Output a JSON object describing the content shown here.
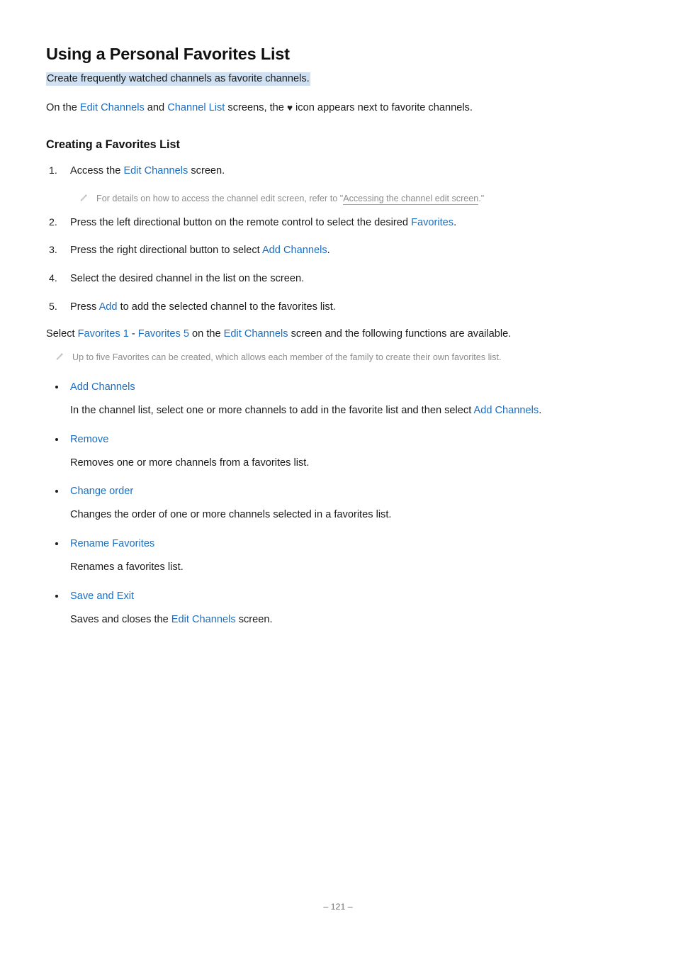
{
  "document": {
    "title": "Using a Personal Favorites List",
    "highlighted_subtitle": "Create frequently watched channels as favorite channels.",
    "intro": {
      "part1": "On the ",
      "link1": "Edit Channels",
      "part2": " and ",
      "link2": "Channel List",
      "part3": " screens, the ",
      "heart_icon": "♥",
      "part4": " icon appears next to favorite channels."
    },
    "section_title": "Creating a Favorites List"
  },
  "steps": [
    {
      "num": "1.",
      "part1": "Access the ",
      "link1": "Edit Channels",
      "part2": " screen."
    },
    {
      "num": "2.",
      "part1": "Press the left directional button on the remote control to select the desired ",
      "link1": "Favorites",
      "part2": "."
    },
    {
      "num": "3.",
      "part1": "Press the right directional button to select ",
      "link1": "Add Channels",
      "part2": "."
    },
    {
      "num": "4.",
      "part1": "Select the desired channel in the list on the screen.",
      "link1": "",
      "part2": ""
    },
    {
      "num": "5.",
      "part1": "Press ",
      "link1": "Add",
      "part2": " to add the selected channel to the favorites list."
    }
  ],
  "notes": {
    "step1_note": {
      "icon": "pencil-icon",
      "part1": "For details on how to access the channel edit screen, refer to \"",
      "link": "Accessing the channel edit screen",
      "part2": ".\""
    },
    "favorites_note": {
      "icon": "pencil-icon",
      "text": "Up to five Favorites can be created, which allows each member of the family to create their own favorites list."
    }
  },
  "select_paragraph": {
    "part1": "Select ",
    "link1": "Favorites 1",
    "part2": " - ",
    "link2": "Favorites 5",
    "part3": " on the ",
    "link3": "Edit Channels",
    "part4": " screen and the following functions are available."
  },
  "features": [
    {
      "label": "Add Channels",
      "desc_part1": "In the channel list, select one or more channels to add in the favorite list and then select ",
      "desc_link": "Add Channels",
      "desc_part2": "."
    },
    {
      "label": "Remove",
      "desc_part1": "Removes one or more channels from a favorites list.",
      "desc_link": "",
      "desc_part2": ""
    },
    {
      "label": "Change order",
      "desc_part1": "Changes the order of one or more channels selected in a favorites list.",
      "desc_link": "",
      "desc_part2": ""
    },
    {
      "label": "Rename Favorites",
      "desc_part1": "Renames a favorites list.",
      "desc_link": "",
      "desc_part2": ""
    },
    {
      "label": "Save and Exit",
      "desc_part1": "Saves and closes the ",
      "desc_link": "Edit Channels",
      "desc_part2": " screen."
    }
  ],
  "footer": {
    "page_number": "– 121 –"
  },
  "colors": {
    "link_blue": "#1b6ec2",
    "highlight_bg": "#cfe0f2",
    "note_gray": "#8c8c8c",
    "body_text": "#1a1a1a"
  }
}
